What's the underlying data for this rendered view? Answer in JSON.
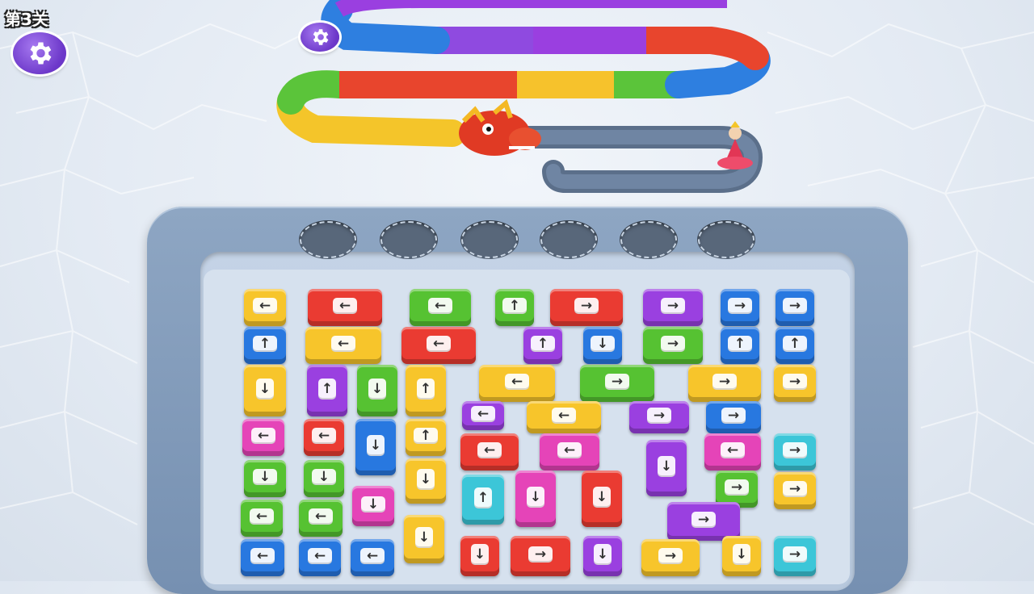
{
  "level": {
    "label": "第3关"
  },
  "buttons": {
    "settings_icon": "gear-icon"
  },
  "colors": {
    "yellow": "#f7c52b",
    "red": "#ea3b32",
    "green": "#56c232",
    "blue": "#2878e0",
    "purple": "#9a40e0",
    "pink": "#e544b8",
    "cyan": "#3cc6d8",
    "board": "#7690b1"
  },
  "goal": {
    "character": "princess"
  },
  "slots": {
    "empty_count": 6
  },
  "tiles": [
    {
      "color": "yellow",
      "dir": "left"
    },
    {
      "color": "red",
      "dir": "left"
    },
    {
      "color": "green",
      "dir": "left"
    },
    {
      "color": "green",
      "dir": "up"
    },
    {
      "color": "red",
      "dir": "right"
    },
    {
      "color": "purple",
      "dir": "right"
    },
    {
      "color": "blue",
      "dir": "right"
    },
    {
      "color": "blue",
      "dir": "right"
    },
    {
      "color": "blue",
      "dir": "up"
    },
    {
      "color": "yellow",
      "dir": "left"
    },
    {
      "color": "red",
      "dir": "left"
    },
    {
      "color": "purple",
      "dir": "up"
    },
    {
      "color": "blue",
      "dir": "down"
    },
    {
      "color": "green",
      "dir": "right"
    },
    {
      "color": "blue",
      "dir": "up"
    },
    {
      "color": "blue",
      "dir": "up"
    },
    {
      "color": "yellow",
      "dir": "down"
    },
    {
      "color": "purple",
      "dir": "up"
    },
    {
      "color": "green",
      "dir": "down"
    },
    {
      "color": "yellow",
      "dir": "up"
    },
    {
      "color": "yellow",
      "dir": "left"
    },
    {
      "color": "green",
      "dir": "right"
    },
    {
      "color": "yellow",
      "dir": "right"
    },
    {
      "color": "yellow",
      "dir": "right"
    },
    {
      "color": "purple",
      "dir": "left"
    },
    {
      "color": "yellow",
      "dir": "left"
    },
    {
      "color": "purple",
      "dir": "right"
    },
    {
      "color": "blue",
      "dir": "right"
    },
    {
      "color": "pink",
      "dir": "left"
    },
    {
      "color": "red",
      "dir": "left"
    },
    {
      "color": "blue",
      "dir": "down"
    },
    {
      "color": "yellow",
      "dir": "up"
    },
    {
      "color": "red",
      "dir": "left"
    },
    {
      "color": "pink",
      "dir": "left"
    },
    {
      "color": "purple",
      "dir": "down"
    },
    {
      "color": "pink",
      "dir": "left"
    },
    {
      "color": "cyan",
      "dir": "right"
    },
    {
      "color": "green",
      "dir": "down"
    },
    {
      "color": "green",
      "dir": "down"
    },
    {
      "color": "yellow",
      "dir": "down"
    },
    {
      "color": "cyan",
      "dir": "up"
    },
    {
      "color": "pink",
      "dir": "down"
    },
    {
      "color": "red",
      "dir": "down"
    },
    {
      "color": "green",
      "dir": "right"
    },
    {
      "color": "yellow",
      "dir": "right"
    },
    {
      "color": "green",
      "dir": "left"
    },
    {
      "color": "green",
      "dir": "left"
    },
    {
      "color": "pink",
      "dir": "down"
    },
    {
      "color": "purple",
      "dir": "right"
    },
    {
      "color": "yellow",
      "dir": "down"
    },
    {
      "color": "blue",
      "dir": "left"
    },
    {
      "color": "blue",
      "dir": "left"
    },
    {
      "color": "blue",
      "dir": "left"
    },
    {
      "color": "red",
      "dir": "down"
    },
    {
      "color": "red",
      "dir": "right"
    },
    {
      "color": "purple",
      "dir": "down"
    },
    {
      "color": "yellow",
      "dir": "right"
    },
    {
      "color": "yellow",
      "dir": "down"
    },
    {
      "color": "cyan",
      "dir": "right"
    }
  ]
}
